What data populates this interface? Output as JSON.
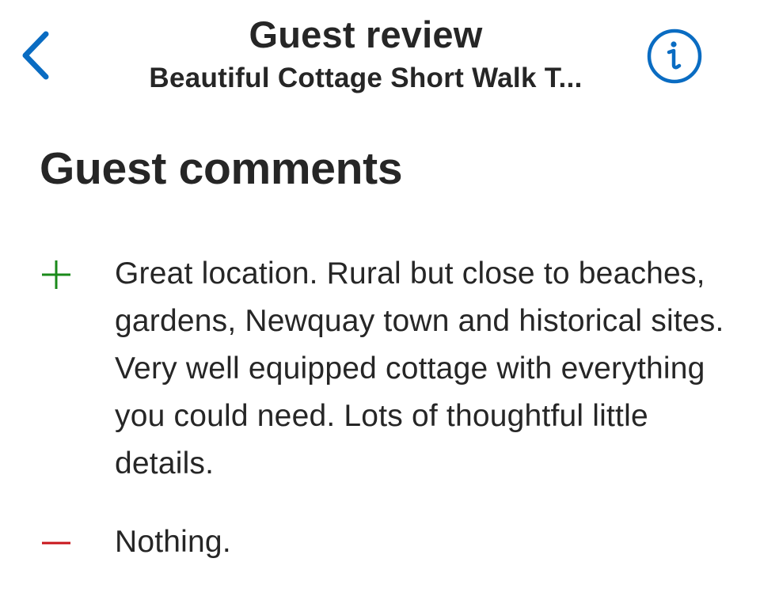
{
  "nav": {
    "title": "Guest review",
    "subtitle": "Beautiful Cottage Short Walk T...",
    "back_icon": "chevron-left-icon",
    "info_icon": "info-circle-icon"
  },
  "section": {
    "heading": "Guest comments"
  },
  "comments": {
    "positive": {
      "icon": "plus-icon",
      "text": "Great location. Rural but close to beaches, gardens, Newquay town and historical sites. Very well equipped cottage with everything you could need. Lots of thoughtful little details."
    },
    "negative": {
      "icon": "minus-icon",
      "text": "Nothing."
    }
  },
  "colors": {
    "accent": "#0a6cc2",
    "text": "#262626",
    "positive": "#1a8a1a",
    "negative": "#c8151b",
    "background": "#ffffff"
  }
}
